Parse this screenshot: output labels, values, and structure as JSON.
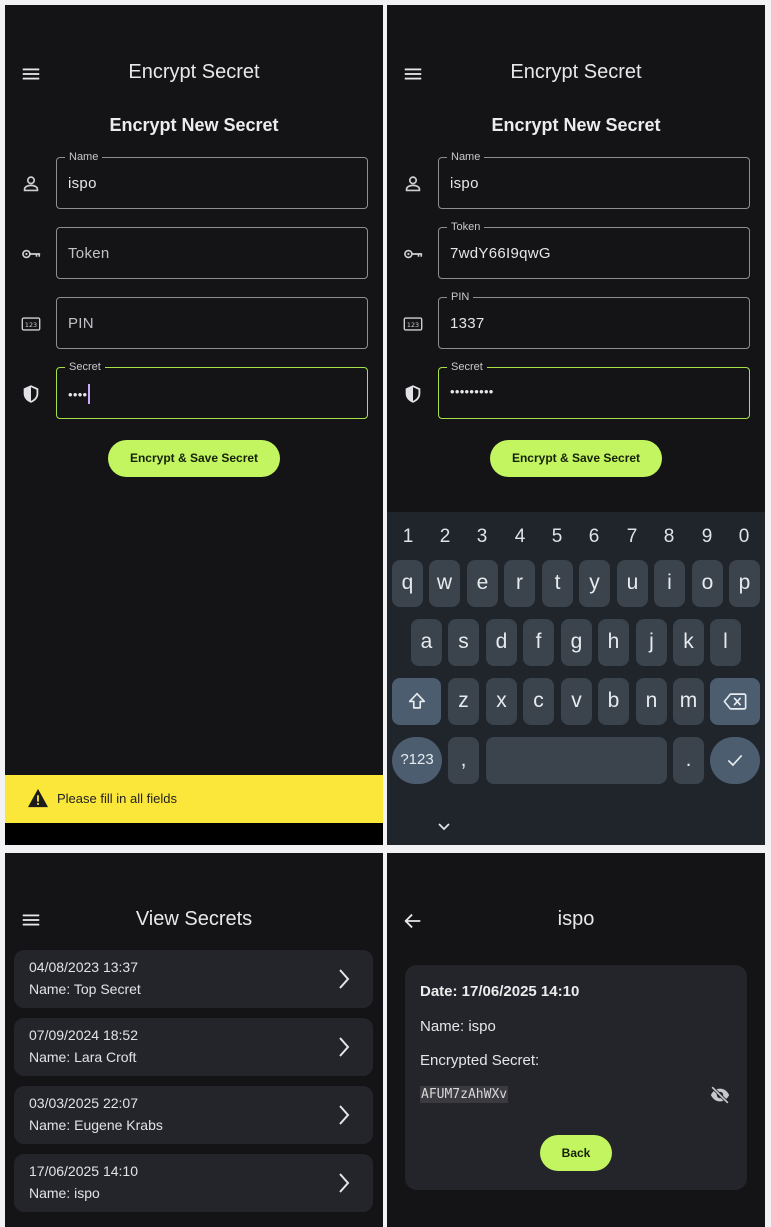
{
  "screen1": {
    "title": "Encrypt Secret",
    "heading": "Encrypt New Secret",
    "fields": {
      "name": {
        "label": "Name",
        "value": "ispo"
      },
      "token": {
        "placeholder": "Token"
      },
      "pin": {
        "placeholder": "PIN"
      },
      "secret": {
        "label": "Secret",
        "value": "••••"
      }
    },
    "button_label": "Encrypt & Save Secret",
    "snackbar": "Please fill in all fields"
  },
  "screen2": {
    "title": "Encrypt Secret",
    "heading": "Encrypt New Secret",
    "fields": {
      "name": {
        "label": "Name",
        "value": "ispo"
      },
      "token": {
        "label": "Token",
        "value": "7wdY66I9qwG"
      },
      "pin": {
        "label": "PIN",
        "value": "1337"
      },
      "secret": {
        "label": "Secret",
        "value": "•••••••••"
      }
    },
    "button_label": "Encrypt & Save Secret",
    "keyboard": {
      "numbers": [
        "1",
        "2",
        "3",
        "4",
        "5",
        "6",
        "7",
        "8",
        "9",
        "0"
      ],
      "row1": [
        "q",
        "w",
        "e",
        "r",
        "t",
        "y",
        "u",
        "i",
        "o",
        "p"
      ],
      "row2": [
        "a",
        "s",
        "d",
        "f",
        "g",
        "h",
        "j",
        "k",
        "l"
      ],
      "row3": [
        "z",
        "x",
        "c",
        "v",
        "b",
        "n",
        "m"
      ],
      "symbols_key": "?123",
      "comma_key": ",",
      "period_key": "."
    }
  },
  "screen3": {
    "title": "View Secrets",
    "items": [
      {
        "date": "04/08/2023 13:37",
        "name": "Name: Top Secret"
      },
      {
        "date": "07/09/2024 18:52",
        "name": "Name: Lara Croft"
      },
      {
        "date": "03/03/2025 22:07",
        "name": "Name: Eugene Krabs"
      },
      {
        "date": "17/06/2025 14:10",
        "name": "Name: ispo"
      }
    ]
  },
  "screen4": {
    "title": "ispo",
    "date": "Date: 17/06/2025 14:10",
    "name": "Name: ispo",
    "encrypted_label": "Encrypted Secret:",
    "encrypted_value": "AFUM7zAhWXv",
    "back_label": "Back"
  },
  "colors": {
    "background": "#141416",
    "accent": "#c2f560",
    "active_border": "#a6e14a",
    "snackbar": "#fbe63a",
    "card": "#24252a",
    "keyboard": "#1f252b"
  },
  "icons": [
    "menu-icon",
    "person-icon",
    "key-icon",
    "pin-icon",
    "shield-icon",
    "warning-icon",
    "shift-icon",
    "backspace-icon",
    "check-icon",
    "chevron-right-icon",
    "arrow-back-icon",
    "eye-off-icon",
    "keyboard-hide-icon"
  ]
}
